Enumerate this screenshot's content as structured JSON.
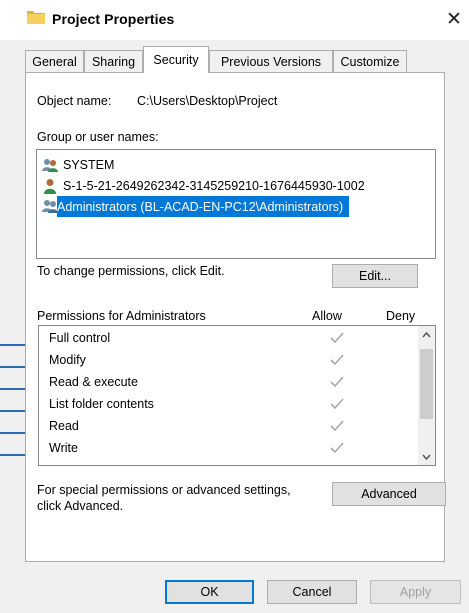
{
  "window": {
    "title": "Project Properties",
    "close_glyph": "✕"
  },
  "tabs": [
    {
      "label": "General"
    },
    {
      "label": "Sharing"
    },
    {
      "label": "Security",
      "active": true
    },
    {
      "label": "Previous Versions"
    },
    {
      "label": "Customize"
    }
  ],
  "security": {
    "object_name_label": "Object name:",
    "object_name_value": "C:\\Users\\Desktop\\Project",
    "groups_label": "Group or user names:",
    "users": [
      {
        "name": "SYSTEM",
        "icon": "group-users-icon"
      },
      {
        "name": "S-1-5-21-2649262342-3145259210-1676445930-1002",
        "icon": "user-icon"
      },
      {
        "name": "Administrators (BL-ACAD-EN-PC12\\Administrators)",
        "icon": "group-users-icon",
        "selected": true
      }
    ],
    "change_hint": "To change permissions, click Edit.",
    "edit_button": "Edit...",
    "permissions_label": "Permissions for Administrators",
    "allow_header": "Allow",
    "deny_header": "Deny",
    "permissions": [
      {
        "name": "Full control",
        "allow": true,
        "deny": false
      },
      {
        "name": "Modify",
        "allow": true,
        "deny": false
      },
      {
        "name": "Read & execute",
        "allow": true,
        "deny": false
      },
      {
        "name": "List folder contents",
        "allow": true,
        "deny": false
      },
      {
        "name": "Read",
        "allow": true,
        "deny": false
      },
      {
        "name": "Write",
        "allow": true,
        "deny": false
      }
    ],
    "advanced_hint_line1": "For special permissions or advanced settings,",
    "advanced_hint_line2": "click Advanced.",
    "advanced_button": "Advanced"
  },
  "footer": {
    "ok": "OK",
    "cancel": "Cancel",
    "apply": "Apply"
  },
  "colors": {
    "selection": "#0078d7",
    "callout": "#2b6cb0"
  }
}
